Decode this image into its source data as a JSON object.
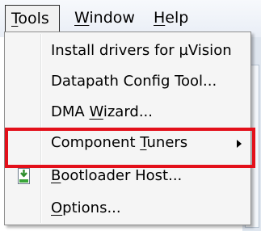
{
  "menubar": {
    "tools": {
      "pre": "",
      "accel": "T",
      "post": "ools"
    },
    "window": {
      "pre": "",
      "accel": "W",
      "post": "indow"
    },
    "help": {
      "pre": "",
      "accel": "H",
      "post": "elp"
    }
  },
  "menu": {
    "items": [
      {
        "pre": "Install drivers for ",
        "accel": "",
        "post": "µVision"
      },
      {
        "pre": "Datapath Config Tool...",
        "accel": "",
        "post": ""
      },
      {
        "pre": "DMA ",
        "accel": "W",
        "post": "izard..."
      },
      {
        "pre": "Component ",
        "accel": "T",
        "post": "uners"
      },
      {
        "pre": "",
        "accel": "B",
        "post": "ootloader Host..."
      },
      {
        "pre": "",
        "accel": "O",
        "post": "ptions..."
      }
    ]
  },
  "colors": {
    "highlight_border": "#e3101a",
    "icon_green": "#3aa63a"
  },
  "icons": {
    "bootloader": "download-arrow-icon",
    "submenu": "chevron-right-icon"
  }
}
